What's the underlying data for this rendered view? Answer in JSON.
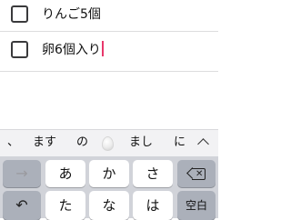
{
  "list": {
    "items": [
      {
        "text": "りんご5個",
        "checked": false
      },
      {
        "text": "卵6個入り",
        "checked": false,
        "editing": true
      }
    ]
  },
  "suggestions": {
    "items": [
      "、",
      "ます",
      "の",
      "まし",
      "に"
    ],
    "emoji": "egg",
    "expand_icon": "chevron-up-icon"
  },
  "keyboard": {
    "row1": {
      "left": "→",
      "keys": [
        "あ",
        "か",
        "さ"
      ],
      "right": "delete-icon"
    },
    "row2": {
      "left": "undo-icon",
      "keys": [
        "た",
        "な",
        "は"
      ],
      "right": "空白"
    }
  },
  "colors": {
    "caret": "#e8386b",
    "keyboard_bg": "#d1d3d9",
    "gray_key": "#abb0ba"
  }
}
